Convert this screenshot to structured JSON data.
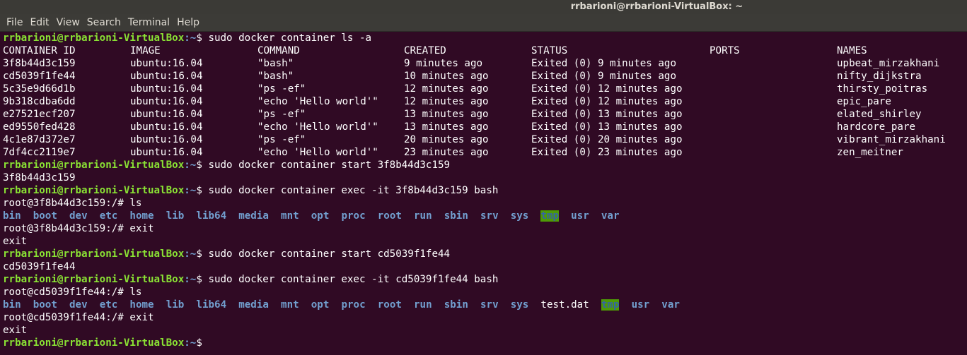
{
  "window": {
    "title": "rrbarioni@rrbarioni-VirtualBox: ~"
  },
  "menu": [
    "File",
    "Edit",
    "View",
    "Search",
    "Terminal",
    "Help"
  ],
  "prompt": {
    "user_host": "rrbarioni@rrbarioni-VirtualBox",
    "path": ":~",
    "sign": "$ "
  },
  "cmd1": "sudo docker container ls -a",
  "table": {
    "headers": [
      "CONTAINER ID",
      "IMAGE",
      "COMMAND",
      "CREATED",
      "STATUS",
      "PORTS",
      "NAMES"
    ],
    "rows": [
      [
        "3f8b44d3c159",
        "ubuntu:16.04",
        "\"bash\"",
        "9 minutes ago",
        "Exited (0) 9 minutes ago",
        "",
        "upbeat_mirzakhani"
      ],
      [
        "cd5039f1fe44",
        "ubuntu:16.04",
        "\"bash\"",
        "10 minutes ago",
        "Exited (0) 9 minutes ago",
        "",
        "nifty_dijkstra"
      ],
      [
        "5c35e9d66d1b",
        "ubuntu:16.04",
        "\"ps -ef\"",
        "12 minutes ago",
        "Exited (0) 12 minutes ago",
        "",
        "thirsty_poitras"
      ],
      [
        "9b318cdba6dd",
        "ubuntu:16.04",
        "\"echo 'Hello world'\"",
        "12 minutes ago",
        "Exited (0) 12 minutes ago",
        "",
        "epic_pare"
      ],
      [
        "e27521ecf207",
        "ubuntu:16.04",
        "\"ps -ef\"",
        "13 minutes ago",
        "Exited (0) 13 minutes ago",
        "",
        "elated_shirley"
      ],
      [
        "ed9550fed428",
        "ubuntu:16.04",
        "\"echo 'Hello world'\"",
        "13 minutes ago",
        "Exited (0) 13 minutes ago",
        "",
        "hardcore_pare"
      ],
      [
        "4c1e87d372e7",
        "ubuntu:16.04",
        "\"ps -ef\"",
        "20 minutes ago",
        "Exited (0) 20 minutes ago",
        "",
        "vibrant_mirzakhani"
      ],
      [
        "7df4cc2119e7",
        "ubuntu:16.04",
        "\"echo 'Hello world'\"",
        "23 minutes ago",
        "Exited (0) 23 minutes ago",
        "",
        "zen_meitner"
      ]
    ]
  },
  "cmd2": "sudo docker container start 3f8b44d3c159",
  "out2": "3f8b44d3c159",
  "cmd3": "sudo docker container exec -it 3f8b44d3c159 bash",
  "root1": {
    "prompt": "root@3f8b44d3c159:/# ",
    "ls": "ls",
    "exit": "exit"
  },
  "ls1": [
    "bin",
    "boot",
    "dev",
    "etc",
    "home",
    "lib",
    "lib64",
    "media",
    "mnt",
    "opt",
    "proc",
    "root",
    "run",
    "sbin",
    "srv",
    "sys",
    "tmp",
    "usr",
    "var"
  ],
  "exit_out": "exit",
  "cmd4": "sudo docker container start cd5039f1fe44",
  "out4": "cd5039f1fe44",
  "cmd5": "sudo docker container exec -it cd5039f1fe44 bash",
  "root2": {
    "prompt": "root@cd5039f1fe44:/# ",
    "ls": "ls",
    "exit": "exit"
  },
  "ls2": [
    "bin",
    "boot",
    "dev",
    "etc",
    "home",
    "lib",
    "lib64",
    "media",
    "mnt",
    "opt",
    "proc",
    "root",
    "run",
    "sbin",
    "srv",
    "sys",
    "test.dat",
    "tmp",
    "usr",
    "var"
  ],
  "colors": {
    "background": "#300a24",
    "prompt_user": "#8ae234",
    "prompt_path": "#729fcf",
    "dir": "#729fcf",
    "tmp_bg": "#4e9a06"
  }
}
